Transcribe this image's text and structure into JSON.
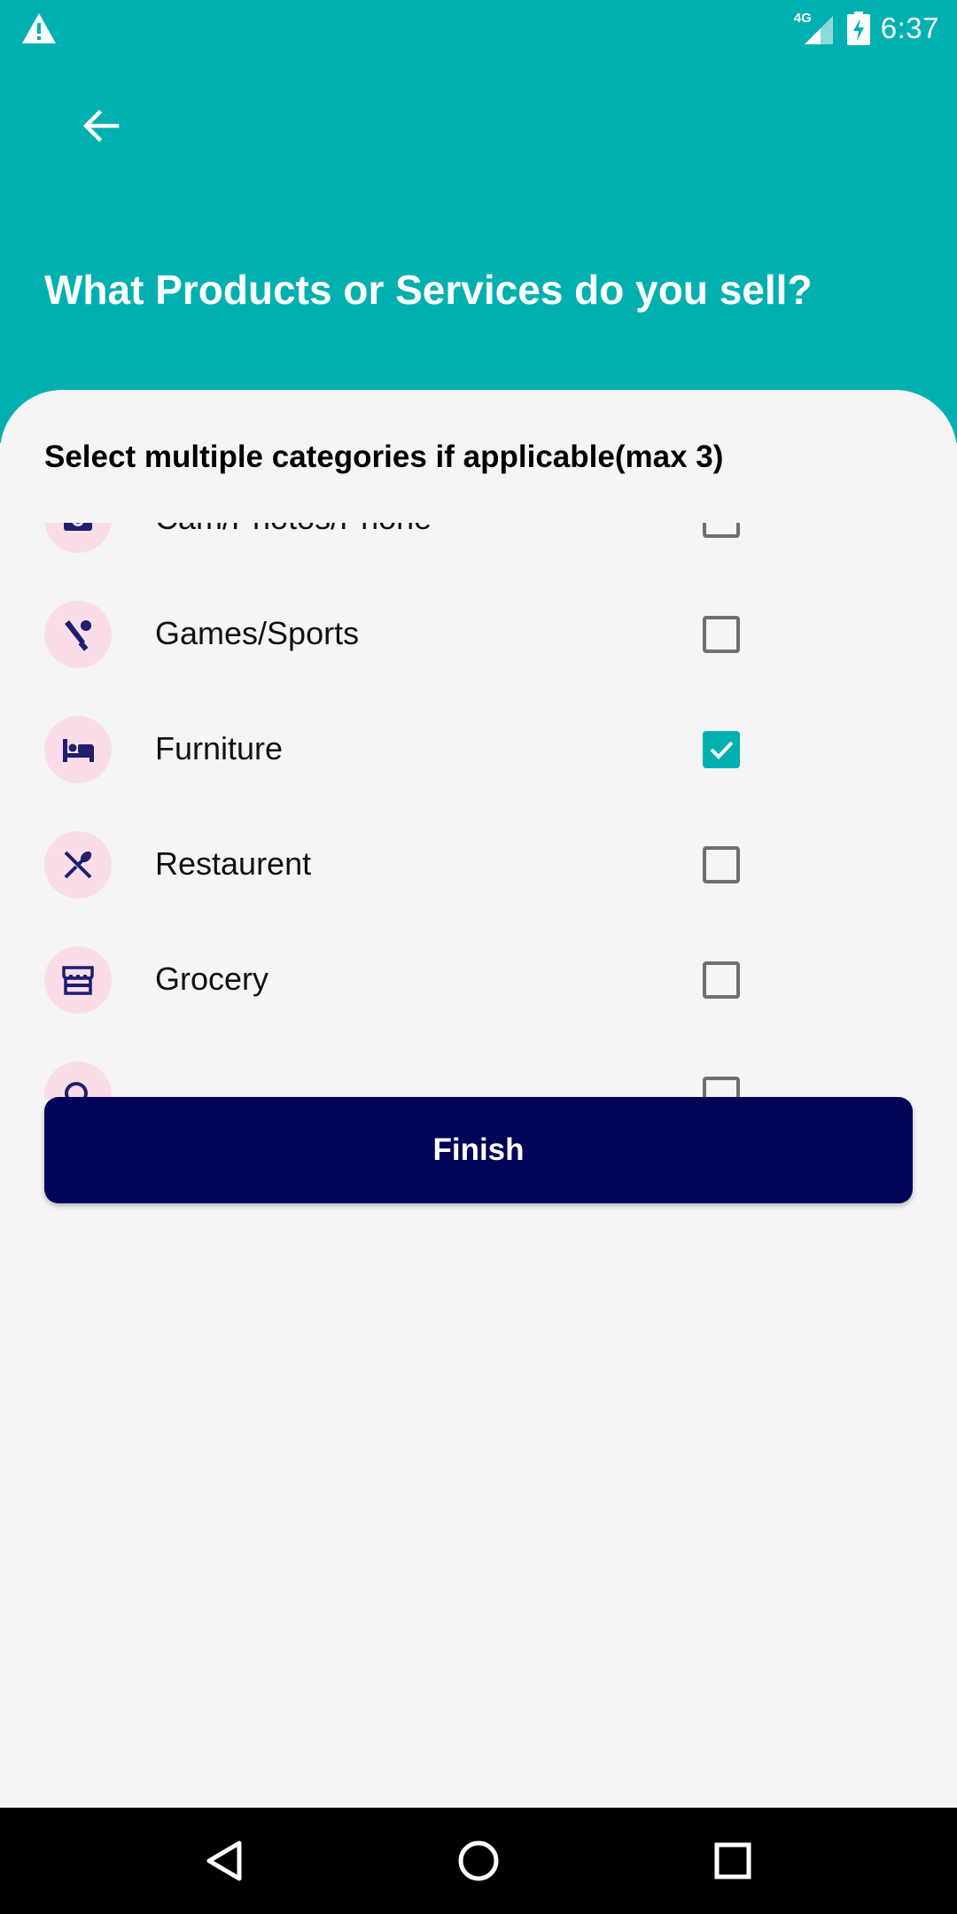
{
  "status_bar": {
    "network": "4G",
    "time": "6:37",
    "warning_icon": "warning-icon",
    "signal_icon": "cell-signal-icon",
    "battery_icon": "battery-charging-icon"
  },
  "header": {
    "back_icon": "arrow-back-icon",
    "title": "What Products or Services do you sell?"
  },
  "main": {
    "subtitle": "Select multiple categories if applicable(max 3)",
    "categories": [
      {
        "label": "Cam/Photos/Phone",
        "icon": "camera-icon",
        "checked": false
      },
      {
        "label": "Games/Sports",
        "icon": "sports-icon",
        "checked": false
      },
      {
        "label": "Furniture",
        "icon": "bed-icon",
        "checked": true
      },
      {
        "label": "Restaurent",
        "icon": "restaurant-icon",
        "checked": false
      },
      {
        "label": "Grocery",
        "icon": "store-icon",
        "checked": false
      },
      {
        "label": "",
        "icon": "search-icon",
        "checked": false
      }
    ],
    "finish_label": "Finish"
  },
  "nav_bar": {
    "back": "nav-back-icon",
    "home": "nav-home-icon",
    "recents": "nav-recents-icon"
  },
  "colors": {
    "accent": "#00b0b0",
    "button": "#020458",
    "icon_bg": "#fadde9",
    "icon_fg": "#1f1f6e"
  }
}
